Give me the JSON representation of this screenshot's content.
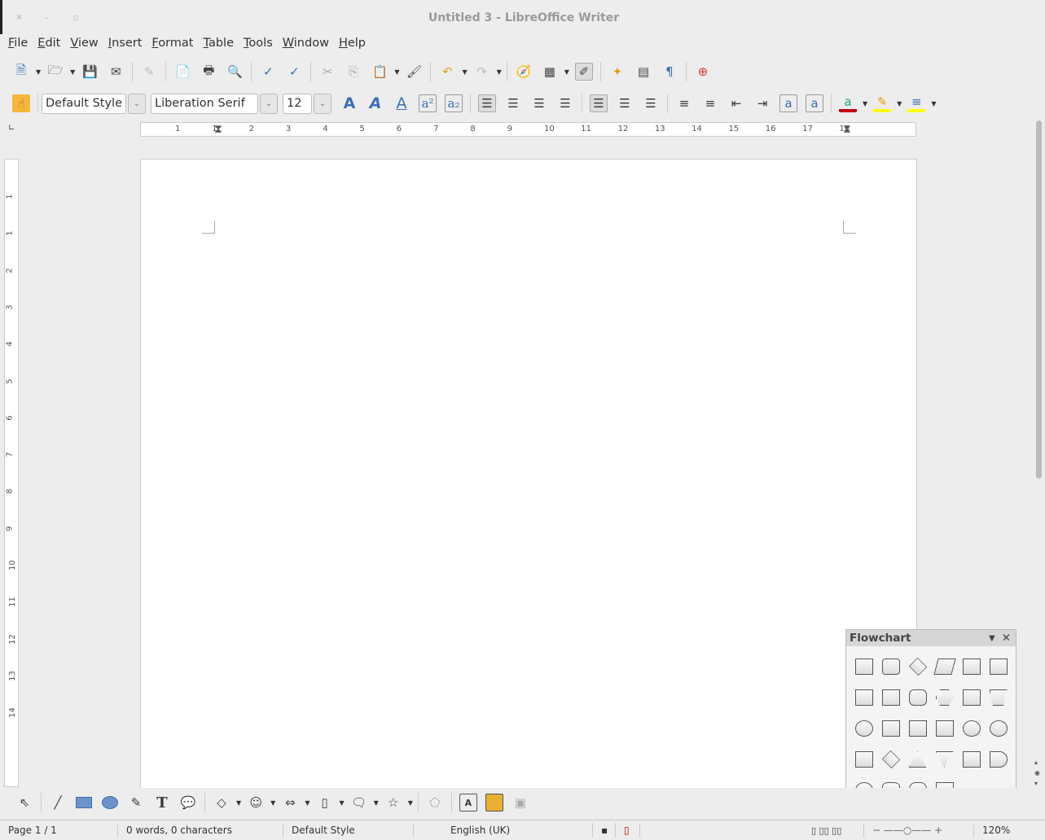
{
  "window": {
    "title": "Untitled 3 - LibreOffice Writer",
    "controls": [
      "close",
      "minimize",
      "maximize"
    ]
  },
  "menubar": [
    {
      "label": "File",
      "u": "F",
      "rest": "ile"
    },
    {
      "label": "Edit",
      "u": "E",
      "rest": "dit"
    },
    {
      "label": "View",
      "u": "V",
      "rest": "iew"
    },
    {
      "label": "Insert",
      "u": "I",
      "rest": "nsert"
    },
    {
      "label": "Format",
      "u": "F",
      "pre": "",
      "rest": "ormat"
    },
    {
      "label": "Table",
      "u": "T",
      "rest": "able"
    },
    {
      "label": "Tools",
      "u": "T",
      "rest": "ools"
    },
    {
      "label": "Window",
      "u": "W",
      "rest": "indow"
    },
    {
      "label": "Help",
      "u": "H",
      "rest": "elp"
    }
  ],
  "standard_toolbar": [
    "new-document",
    "open",
    "save",
    "email",
    "edit-file",
    "export-pdf",
    "print",
    "print-preview",
    "spellcheck",
    "autospellcheck",
    "cut",
    "copy",
    "paste",
    "clone-formatting",
    "undo",
    "redo",
    "navigator",
    "table",
    "show-draw-functions",
    "gallery",
    "data-sources",
    "nonprinting-chars",
    "help"
  ],
  "formatting": {
    "paragraph_style": "Default Style",
    "font_name": "Liberation Serif",
    "font_size": "12"
  },
  "ruler": {
    "h_labels": [
      "1",
      "1",
      "2",
      "3",
      "4",
      "5",
      "6",
      "7",
      "8",
      "9",
      "10",
      "11",
      "12",
      "13",
      "14",
      "15",
      "16",
      "17",
      "18"
    ],
    "v_labels": [
      "1",
      "1",
      "2",
      "3",
      "4",
      "5",
      "6",
      "7",
      "8",
      "9",
      "10",
      "11",
      "12",
      "13",
      "14"
    ]
  },
  "flowchart": {
    "title": "Flowchart"
  },
  "status": {
    "page": "Page 1 / 1",
    "words": "0 words, 0 characters",
    "style": "Default Style",
    "language": "English (UK)",
    "zoom": "120%"
  },
  "colors": {
    "accent": "#3b6fb6",
    "font_color": "#c00000",
    "highlight": "#ffff00"
  }
}
